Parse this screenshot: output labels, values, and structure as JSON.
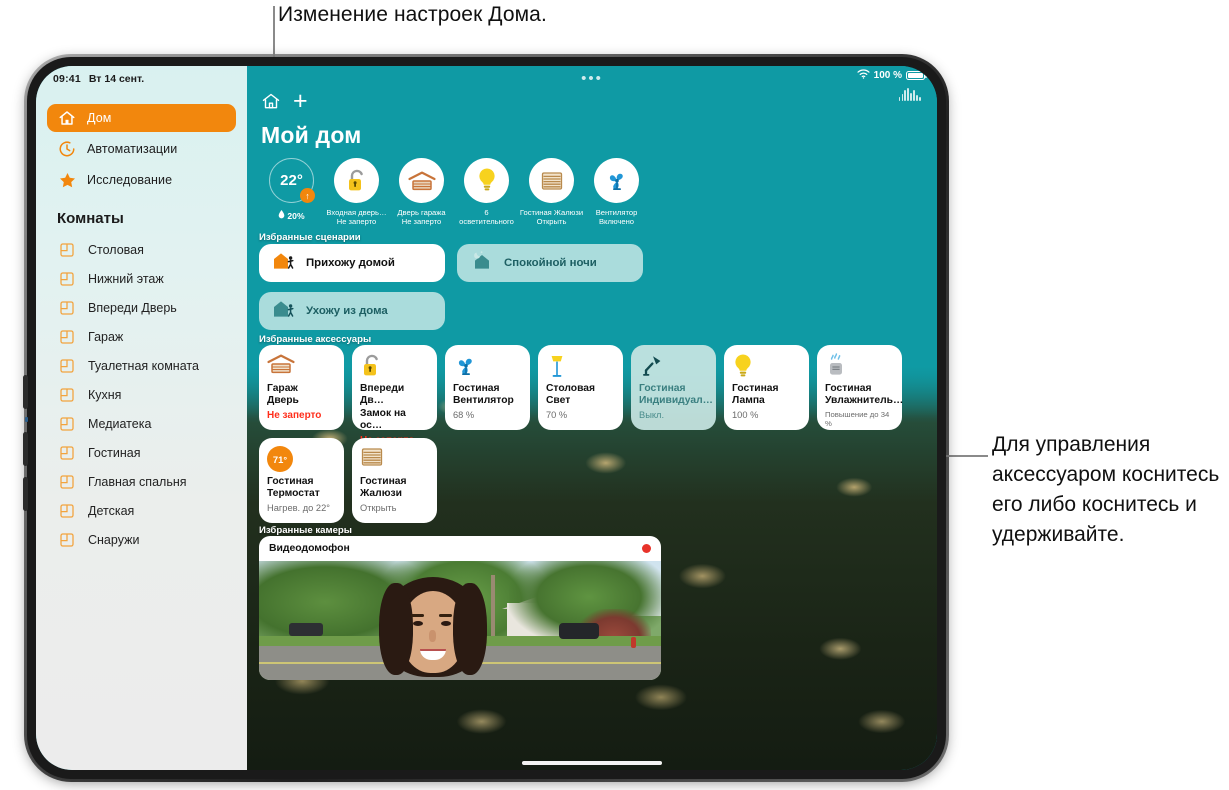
{
  "annotations": {
    "top": "Изменение настроек Дома.",
    "right": "Для управления аксессуаром коснитесь его либо коснитесь и удерживайте."
  },
  "status_bar": {
    "time": "09:41",
    "date": "Вт 14 сент.",
    "wifi_icon": "wifi-icon",
    "battery_percent": "100 %",
    "battery_icon": "battery-icon",
    "siri_icon": "siri-waveform-icon",
    "multitask_icon": "multitasking-dots-icon"
  },
  "sidebar": {
    "nav": [
      {
        "label": "Дом",
        "icon": "house-icon",
        "active": true
      },
      {
        "label": "Автоматизации",
        "icon": "clock-icon",
        "active": false
      },
      {
        "label": "Исследование",
        "icon": "star-icon",
        "active": false
      }
    ],
    "rooms_title": "Комнаты",
    "rooms": [
      {
        "label": "Столовая",
        "icon": "room-icon"
      },
      {
        "label": "Нижний этаж",
        "icon": "room-icon"
      },
      {
        "label": "Впереди Дверь",
        "icon": "room-icon"
      },
      {
        "label": "Гараж",
        "icon": "room-icon"
      },
      {
        "label": "Туалетная комната",
        "icon": "room-icon"
      },
      {
        "label": "Кухня",
        "icon": "room-icon"
      },
      {
        "label": "Медиатека",
        "icon": "room-icon"
      },
      {
        "label": "Гостиная",
        "icon": "room-icon"
      },
      {
        "label": "Главная спальня",
        "icon": "room-icon"
      },
      {
        "label": "Детская",
        "icon": "room-icon"
      },
      {
        "label": "Снаружи",
        "icon": "room-icon"
      }
    ]
  },
  "toolbar": {
    "home_icon": "house-icon",
    "add_icon": "plus-icon"
  },
  "main": {
    "title": "Мой дом",
    "status_chips": [
      {
        "kind": "climate",
        "temperature": "22°",
        "humidity": "20%",
        "humidity_icon": "droplet-icon",
        "badge_icon": "heat-up-arrow-icon"
      },
      {
        "kind": "device",
        "icon": "unlocked-padlock-icon",
        "line1": "Входная дверь…",
        "line2": "Не заперто"
      },
      {
        "kind": "device",
        "icon": "garage-door-icon",
        "line1": "Дверь гаража",
        "line2": "Не заперто"
      },
      {
        "kind": "device",
        "icon": "lightbulb-icon",
        "line1": "6",
        "line2": "осветительного"
      },
      {
        "kind": "device",
        "icon": "blinds-icon",
        "line1": "Гостиная Жалюзи",
        "line2": "Открыть"
      },
      {
        "kind": "device",
        "icon": "fan-icon",
        "line1": "Вентилятор",
        "line2": "Включено"
      }
    ],
    "scenes_title": "Избранные сценарии",
    "scenes": [
      {
        "label": "Прихожу домой",
        "icon": "house-person-arrive-icon",
        "state": "on"
      },
      {
        "label": "Спокойной ночи",
        "icon": "house-moon-icon",
        "state": "off"
      },
      {
        "label": "Ухожу из дома",
        "icon": "house-person-leave-icon",
        "state": "off"
      }
    ],
    "accessories_title": "Избранные аксессуары",
    "accessories": [
      {
        "icon": "garage-door-icon",
        "line1": "Гараж",
        "line2": "Дверь",
        "status": "Не заперто",
        "status_style": "red",
        "state": "on"
      },
      {
        "icon": "unlocked-padlock-icon",
        "line1": "Впереди Дв…",
        "line2": "Замок на ос…",
        "status": "Не заперто",
        "status_style": "red",
        "state": "on"
      },
      {
        "icon": "fan-icon",
        "line1": "Гостиная",
        "line2": "Вентилятор",
        "status": "68 %",
        "status_style": "normal",
        "state": "on"
      },
      {
        "icon": "floor-lamp-icon",
        "line1": "Столовая",
        "line2": "Свет",
        "status": "70 %",
        "status_style": "normal",
        "state": "on"
      },
      {
        "icon": "desk-lamp-icon",
        "line1": "Гостиная",
        "line2": "Индивидуал…",
        "status": "Выкл.",
        "status_style": "normal",
        "state": "off"
      },
      {
        "icon": "lightbulb-icon",
        "line1": "Гостиная",
        "line2": "Лампа",
        "status": "100 %",
        "status_style": "normal",
        "state": "on"
      },
      {
        "icon": "humidifier-icon",
        "line1": "Гостиная",
        "line2": "Увлажнитель…",
        "status": "Повышение до 34 %",
        "status_style": "small",
        "state": "on"
      },
      {
        "icon": "thermostat-icon",
        "badge": "71°",
        "line1": "Гостиная",
        "line2": "Термостат",
        "status": "Нагрев. до 22°",
        "status_style": "normal",
        "state": "on"
      },
      {
        "icon": "blinds-icon",
        "line1": "Гостиная",
        "line2": "Жалюзи",
        "status": "Открыть",
        "status_style": "normal",
        "state": "on"
      }
    ],
    "cameras_title": "Избранные камеры",
    "cameras": [
      {
        "name": "Видеодомофон",
        "recording_icon": "recording-dot-icon"
      }
    ]
  },
  "colors": {
    "accent_orange": "#f2870d",
    "teal_bg": "#0f9aa4",
    "alert_red": "#ff2d1a",
    "sidebar_top": "#d9f1f0"
  }
}
